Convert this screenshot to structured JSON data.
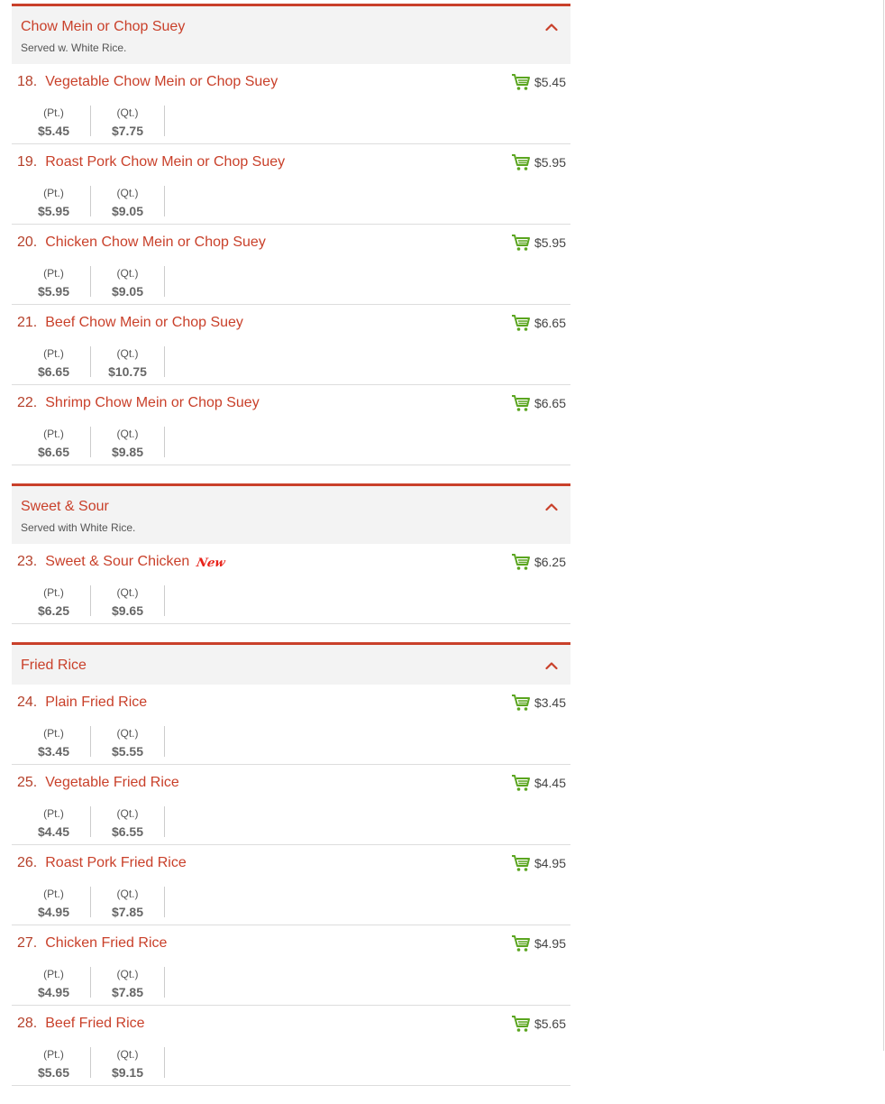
{
  "colors": {
    "accent": "#c9402a",
    "new_badge": "#e8231a",
    "cart_green": "#5aa51f",
    "header_bg": "#f3f3f3"
  },
  "categories": [
    {
      "title": "Chow Mein or Chop Suey",
      "description": "Served w. White Rice.",
      "items": [
        {
          "num": "18.",
          "name": "Vegetable Chow Mein or Chop Suey",
          "cart_price": "$5.45",
          "sizes": [
            {
              "label": "(Pt.)",
              "price": "$5.45"
            },
            {
              "label": "(Qt.)",
              "price": "$7.75"
            }
          ]
        },
        {
          "num": "19.",
          "name": "Roast Pork Chow Mein or Chop Suey",
          "cart_price": "$5.95",
          "sizes": [
            {
              "label": "(Pt.)",
              "price": "$5.95"
            },
            {
              "label": "(Qt.)",
              "price": "$9.05"
            }
          ]
        },
        {
          "num": "20.",
          "name": "Chicken Chow Mein or Chop Suey",
          "cart_price": "$5.95",
          "sizes": [
            {
              "label": "(Pt.)",
              "price": "$5.95"
            },
            {
              "label": "(Qt.)",
              "price": "$9.05"
            }
          ]
        },
        {
          "num": "21.",
          "name": "Beef Chow Mein or Chop Suey",
          "cart_price": "$6.65",
          "sizes": [
            {
              "label": "(Pt.)",
              "price": "$6.65"
            },
            {
              "label": "(Qt.)",
              "price": "$10.75"
            }
          ]
        },
        {
          "num": "22.",
          "name": "Shrimp Chow Mein or Chop Suey",
          "cart_price": "$6.65",
          "sizes": [
            {
              "label": "(Pt.)",
              "price": "$6.65"
            },
            {
              "label": "(Qt.)",
              "price": "$9.85"
            }
          ]
        }
      ]
    },
    {
      "title": "Sweet & Sour",
      "description": "Served with White Rice.",
      "items": [
        {
          "num": "23.",
          "name": "Sweet & Sour Chicken",
          "badge": "New",
          "cart_price": "$6.25",
          "sizes": [
            {
              "label": "(Pt.)",
              "price": "$6.25"
            },
            {
              "label": "(Qt.)",
              "price": "$9.65"
            }
          ]
        }
      ]
    },
    {
      "title": "Fried Rice",
      "description": "",
      "items": [
        {
          "num": "24.",
          "name": "Plain Fried Rice",
          "cart_price": "$3.45",
          "sizes": [
            {
              "label": "(Pt.)",
              "price": "$3.45"
            },
            {
              "label": "(Qt.)",
              "price": "$5.55"
            }
          ]
        },
        {
          "num": "25.",
          "name": "Vegetable Fried Rice",
          "cart_price": "$4.45",
          "sizes": [
            {
              "label": "(Pt.)",
              "price": "$4.45"
            },
            {
              "label": "(Qt.)",
              "price": "$6.55"
            }
          ]
        },
        {
          "num": "26.",
          "name": "Roast Pork Fried Rice",
          "cart_price": "$4.95",
          "sizes": [
            {
              "label": "(Pt.)",
              "price": "$4.95"
            },
            {
              "label": "(Qt.)",
              "price": "$7.85"
            }
          ]
        },
        {
          "num": "27.",
          "name": "Chicken Fried Rice",
          "cart_price": "$4.95",
          "sizes": [
            {
              "label": "(Pt.)",
              "price": "$4.95"
            },
            {
              "label": "(Qt.)",
              "price": "$7.85"
            }
          ]
        },
        {
          "num": "28.",
          "name": "Beef Fried Rice",
          "cart_price": "$5.65",
          "sizes": [
            {
              "label": "(Pt.)",
              "price": "$5.65"
            },
            {
              "label": "(Qt.)",
              "price": "$9.15"
            }
          ]
        }
      ]
    }
  ]
}
